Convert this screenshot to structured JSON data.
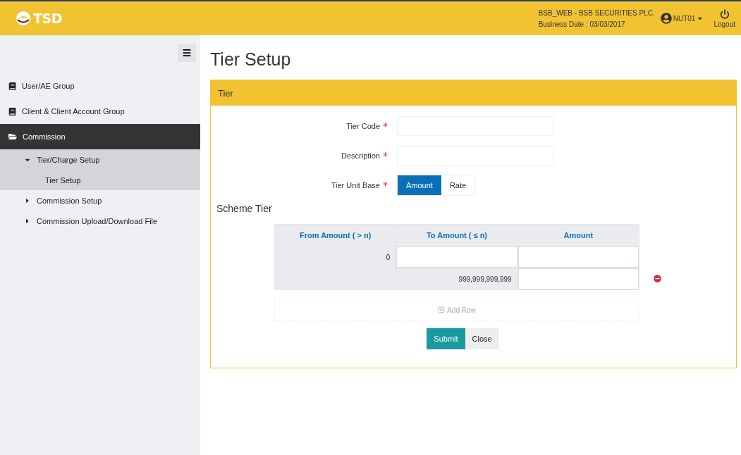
{
  "header": {
    "logo": "TSD",
    "company": "BSB_WEB - BSB SECURITIES PLC.",
    "business_date": "Business Date : 03/03/2017",
    "user": "NUT01",
    "logout": "Logout"
  },
  "sidebar": {
    "items": [
      {
        "label": "User/AE Group",
        "expanded": false
      },
      {
        "label": "Client & Client Account Group",
        "expanded": false
      },
      {
        "label": "Commission",
        "expanded": true,
        "children": [
          {
            "label": "Tier/Charge Setup",
            "expanded": true,
            "children": [
              {
                "label": "Tier Setup",
                "selected": true
              }
            ]
          },
          {
            "label": "Commission Setup",
            "expanded": false
          },
          {
            "label": "Commission Upload/Download File",
            "expanded": false
          }
        ]
      }
    ]
  },
  "page_title": "Tier Setup",
  "panel": {
    "title": "Tier",
    "fields": [
      {
        "label": "Tier Code",
        "marker": "*",
        "kind": "text"
      },
      {
        "label": "Description",
        "marker": "*",
        "kind": "text"
      },
      {
        "label": "Tier Unit Base",
        "marker": "*",
        "kind": "toggle",
        "options": [
          {
            "label": "Amount",
            "selected": true
          },
          {
            "label": "Rate",
            "selected": false
          }
        ]
      }
    ],
    "section_title": "Scheme Tier",
    "table": {
      "columns": [
        "From Amount ( > n)",
        "To Amount ( ≤ n)",
        "Amount"
      ],
      "rows": [
        {
          "removable": false,
          "cells": [
            {
              "value": "0",
              "editable": false
            },
            {
              "editable": true
            },
            {
              "editable": true
            }
          ]
        },
        {
          "removable": true,
          "cells": [
            {
              "editable": false
            },
            {
              "value": "999,999,999,999",
              "editable": false
            },
            {
              "editable": true
            }
          ]
        }
      ]
    },
    "add_row": "Add Row",
    "buttons": [
      {
        "label": "Submit",
        "kind": "primary"
      },
      {
        "label": "Close",
        "kind": "default"
      }
    ]
  }
}
